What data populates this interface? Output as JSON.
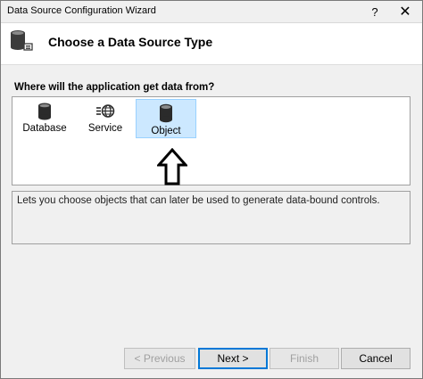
{
  "window": {
    "title": "Data Source Configuration Wizard",
    "help": "?",
    "close": "✕"
  },
  "header": {
    "title": "Choose a Data Source Type"
  },
  "prompt": "Where will the application get data from?",
  "types": [
    {
      "label": "Database"
    },
    {
      "label": "Service"
    },
    {
      "label": "Object",
      "selected": true
    }
  ],
  "description": "Lets you choose objects that can later be used to generate data-bound controls.",
  "buttons": {
    "previous": "< Previous",
    "next": "Next >",
    "finish": "Finish",
    "cancel": "Cancel"
  },
  "colors": {
    "selection": "#cce8ff",
    "focus": "#0078d7"
  }
}
